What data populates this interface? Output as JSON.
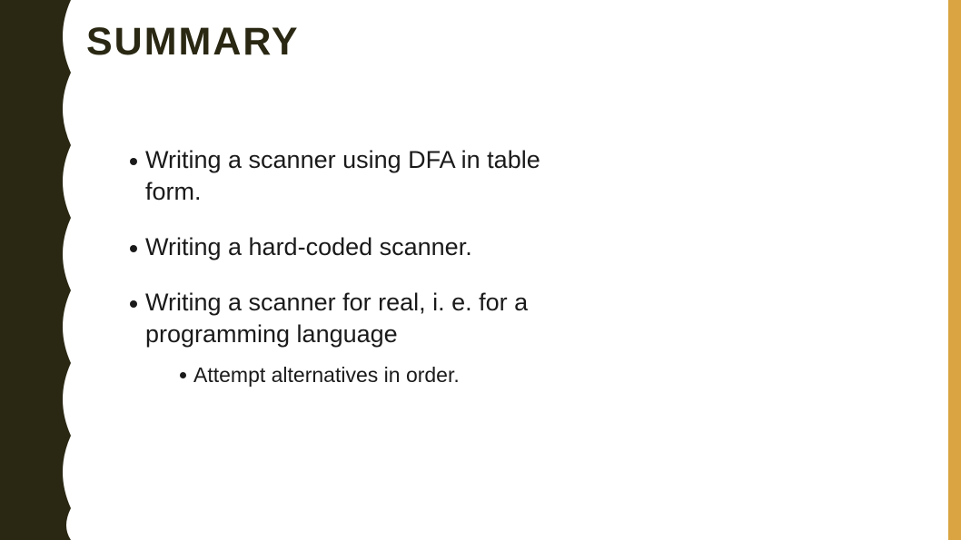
{
  "title": "SUMMARY",
  "bullets": [
    {
      "text": "Writing a scanner using DFA in table form."
    },
    {
      "text": "Writing a hard-coded scanner."
    },
    {
      "text": "Writing a scanner for real, i. e. for a programming language"
    }
  ],
  "sub_bullets": [
    {
      "text": "Attempt alternatives in order."
    }
  ],
  "colors": {
    "left_stripe": "#2a2813",
    "right_stripe": "#d9a441",
    "text": "#1a1a1a"
  }
}
